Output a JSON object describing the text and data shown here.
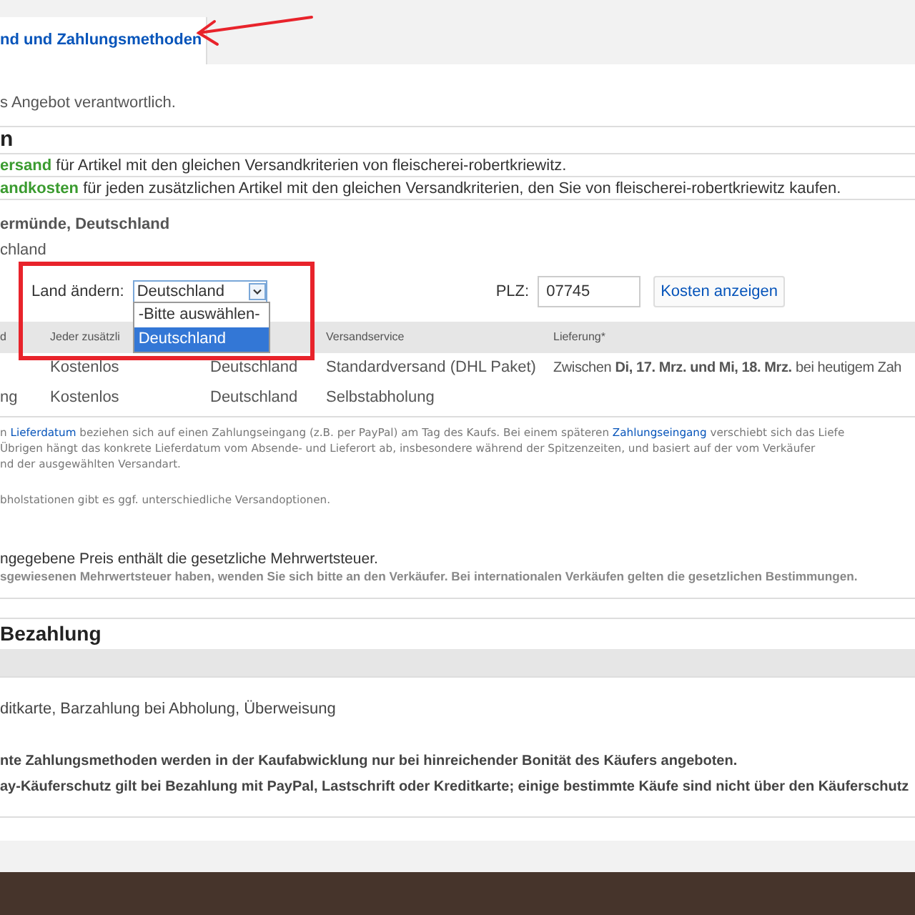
{
  "tabs": [
    {
      "label": "nd und Zahlungsmethoden",
      "selected": true
    }
  ],
  "intro": "s Angebot verantwortlich.",
  "shipping_heading": "n",
  "shipping_rules": [
    {
      "parts": [
        {
          "text": "ersand",
          "kind": "highlight"
        },
        {
          "text": " für Artikel mit den gleichen Versandkriterien von fleischerei-robertkriewitz.",
          "kind": "plain"
        }
      ]
    },
    {
      "parts": [
        {
          "text": "andkosten",
          "kind": "highlight"
        },
        {
          "text": " für jeden zusätzlichen Artikel mit den gleichen Versandkriterien, den Sie von fleischerei-robertkriewitz kaufen.",
          "kind": "plain"
        }
      ]
    }
  ],
  "location": "ermünde, Deutschland",
  "ships_to": "chland",
  "country_select": {
    "label": "Land ändern:",
    "value": "Deutschland",
    "expanded": true,
    "options": [
      {
        "label": "-Bitte auswählen-",
        "selected": false
      },
      {
        "label": "Deutschland",
        "selected": true
      }
    ]
  },
  "postcode": {
    "label": "PLZ:",
    "value": "07745"
  },
  "show_costs_button": "Kosten anzeigen",
  "table": {
    "columns": [
      "d",
      "Jeder zusätzli",
      "",
      "Versandservice",
      "Lieferung*"
    ],
    "rows": [
      [
        "",
        "Kostenlos",
        "Deutschland",
        "Standardversand (DHL Paket)",
        "Zwischen **Di, 17. Mrz. und Mi, 18. Mrz.** bei heutigem Zah"
      ],
      [
        "ng",
        "Kostenlos",
        "Deutschland",
        "Selbstabholung",
        ""
      ]
    ]
  },
  "delivery_note": [
    {
      "parts": [
        {
          "text": "n ",
          "kind": "plain"
        },
        {
          "text": "Lieferdatum",
          "kind": "link"
        },
        {
          "text": " beziehen sich auf einen Zahlungseingang (z.B. per PayPal) am Tag des Kaufs. Bei einem späteren ",
          "kind": "plain"
        },
        {
          "text": "Zahlungseingang",
          "kind": "link"
        },
        {
          "text": " verschiebt sich das Liefe",
          "kind": "plain"
        }
      ]
    },
    {
      "parts": [
        {
          "text": "Übrigen hängt das konkrete Lieferdatum vom Absende- und Lieferort ab, insbesondere während der Spitzenzeiten, und basiert auf der vom Verkäufer",
          "kind": "plain"
        }
      ]
    },
    {
      "parts": [
        {
          "text": "nd der ausgewählten Versandart.",
          "kind": "plain"
        }
      ]
    }
  ],
  "pickup_note": "bholstationen gibt es ggf. unterschiedliche Versandoptionen.",
  "vat_note": "ngegebene Preis enthält die gesetzliche Mehrwertsteuer.",
  "vat_hint": "sgewiesenen Mehrwertsteuer haben, wenden Sie sich bitte an den Verkäufer. Bei internationalen Verkäufen gelten die gesetzlichen Bestimmungen.",
  "payment_heading": "Bezahlung",
  "payment_methods": "ditkarte, Barzahlung bei Abholung, Überweisung",
  "payment_notes": [
    "nte Zahlungsmethoden werden in der Kaufabwicklung nur bei hinreichender Bonität des Käufers angeboten.",
    "ay-Käuferschutz gilt bei Bezahlung mit PayPal, Lastschrift oder Kreditkarte; einige bestimmte Käufe sind nicht über den Käuferschutz"
  ]
}
